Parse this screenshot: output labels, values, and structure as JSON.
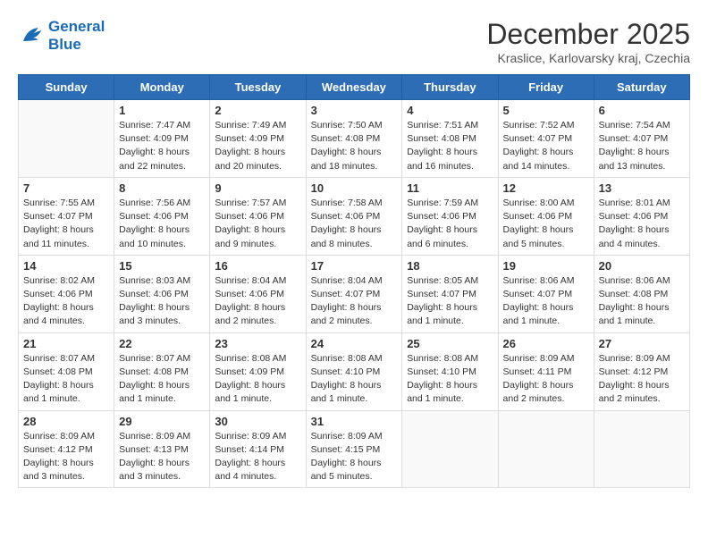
{
  "header": {
    "logo_line1": "General",
    "logo_line2": "Blue",
    "month_title": "December 2025",
    "subtitle": "Kraslice, Karlovarsky kraj, Czechia"
  },
  "weekdays": [
    "Sunday",
    "Monday",
    "Tuesday",
    "Wednesday",
    "Thursday",
    "Friday",
    "Saturday"
  ],
  "weeks": [
    [
      {
        "day": "",
        "info": ""
      },
      {
        "day": "1",
        "info": "Sunrise: 7:47 AM\nSunset: 4:09 PM\nDaylight: 8 hours\nand 22 minutes."
      },
      {
        "day": "2",
        "info": "Sunrise: 7:49 AM\nSunset: 4:09 PM\nDaylight: 8 hours\nand 20 minutes."
      },
      {
        "day": "3",
        "info": "Sunrise: 7:50 AM\nSunset: 4:08 PM\nDaylight: 8 hours\nand 18 minutes."
      },
      {
        "day": "4",
        "info": "Sunrise: 7:51 AM\nSunset: 4:08 PM\nDaylight: 8 hours\nand 16 minutes."
      },
      {
        "day": "5",
        "info": "Sunrise: 7:52 AM\nSunset: 4:07 PM\nDaylight: 8 hours\nand 14 minutes."
      },
      {
        "day": "6",
        "info": "Sunrise: 7:54 AM\nSunset: 4:07 PM\nDaylight: 8 hours\nand 13 minutes."
      }
    ],
    [
      {
        "day": "7",
        "info": "Sunrise: 7:55 AM\nSunset: 4:07 PM\nDaylight: 8 hours\nand 11 minutes."
      },
      {
        "day": "8",
        "info": "Sunrise: 7:56 AM\nSunset: 4:06 PM\nDaylight: 8 hours\nand 10 minutes."
      },
      {
        "day": "9",
        "info": "Sunrise: 7:57 AM\nSunset: 4:06 PM\nDaylight: 8 hours\nand 9 minutes."
      },
      {
        "day": "10",
        "info": "Sunrise: 7:58 AM\nSunset: 4:06 PM\nDaylight: 8 hours\nand 8 minutes."
      },
      {
        "day": "11",
        "info": "Sunrise: 7:59 AM\nSunset: 4:06 PM\nDaylight: 8 hours\nand 6 minutes."
      },
      {
        "day": "12",
        "info": "Sunrise: 8:00 AM\nSunset: 4:06 PM\nDaylight: 8 hours\nand 5 minutes."
      },
      {
        "day": "13",
        "info": "Sunrise: 8:01 AM\nSunset: 4:06 PM\nDaylight: 8 hours\nand 4 minutes."
      }
    ],
    [
      {
        "day": "14",
        "info": "Sunrise: 8:02 AM\nSunset: 4:06 PM\nDaylight: 8 hours\nand 4 minutes."
      },
      {
        "day": "15",
        "info": "Sunrise: 8:03 AM\nSunset: 4:06 PM\nDaylight: 8 hours\nand 3 minutes."
      },
      {
        "day": "16",
        "info": "Sunrise: 8:04 AM\nSunset: 4:06 PM\nDaylight: 8 hours\nand 2 minutes."
      },
      {
        "day": "17",
        "info": "Sunrise: 8:04 AM\nSunset: 4:07 PM\nDaylight: 8 hours\nand 2 minutes."
      },
      {
        "day": "18",
        "info": "Sunrise: 8:05 AM\nSunset: 4:07 PM\nDaylight: 8 hours\nand 1 minute."
      },
      {
        "day": "19",
        "info": "Sunrise: 8:06 AM\nSunset: 4:07 PM\nDaylight: 8 hours\nand 1 minute."
      },
      {
        "day": "20",
        "info": "Sunrise: 8:06 AM\nSunset: 4:08 PM\nDaylight: 8 hours\nand 1 minute."
      }
    ],
    [
      {
        "day": "21",
        "info": "Sunrise: 8:07 AM\nSunset: 4:08 PM\nDaylight: 8 hours\nand 1 minute."
      },
      {
        "day": "22",
        "info": "Sunrise: 8:07 AM\nSunset: 4:08 PM\nDaylight: 8 hours\nand 1 minute."
      },
      {
        "day": "23",
        "info": "Sunrise: 8:08 AM\nSunset: 4:09 PM\nDaylight: 8 hours\nand 1 minute."
      },
      {
        "day": "24",
        "info": "Sunrise: 8:08 AM\nSunset: 4:10 PM\nDaylight: 8 hours\nand 1 minute."
      },
      {
        "day": "25",
        "info": "Sunrise: 8:08 AM\nSunset: 4:10 PM\nDaylight: 8 hours\nand 1 minute."
      },
      {
        "day": "26",
        "info": "Sunrise: 8:09 AM\nSunset: 4:11 PM\nDaylight: 8 hours\nand 2 minutes."
      },
      {
        "day": "27",
        "info": "Sunrise: 8:09 AM\nSunset: 4:12 PM\nDaylight: 8 hours\nand 2 minutes."
      }
    ],
    [
      {
        "day": "28",
        "info": "Sunrise: 8:09 AM\nSunset: 4:12 PM\nDaylight: 8 hours\nand 3 minutes."
      },
      {
        "day": "29",
        "info": "Sunrise: 8:09 AM\nSunset: 4:13 PM\nDaylight: 8 hours\nand 3 minutes."
      },
      {
        "day": "30",
        "info": "Sunrise: 8:09 AM\nSunset: 4:14 PM\nDaylight: 8 hours\nand 4 minutes."
      },
      {
        "day": "31",
        "info": "Sunrise: 8:09 AM\nSunset: 4:15 PM\nDaylight: 8 hours\nand 5 minutes."
      },
      {
        "day": "",
        "info": ""
      },
      {
        "day": "",
        "info": ""
      },
      {
        "day": "",
        "info": ""
      }
    ]
  ]
}
